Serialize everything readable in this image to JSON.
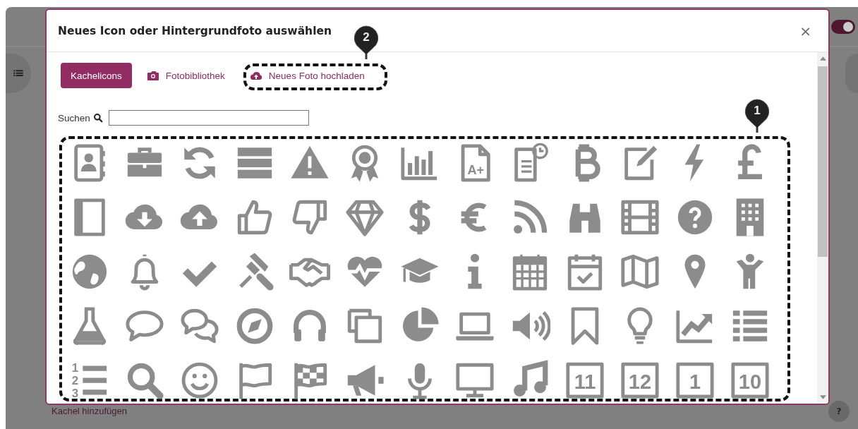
{
  "background": {
    "footer_link": "Kachel hinzufügen",
    "help_button": "?",
    "toggle": {
      "on": true
    }
  },
  "dialog": {
    "title": "Neues Icon oder Hintergrundfoto auswählen",
    "close": "×",
    "tabs": [
      {
        "label": "Kachelicons",
        "selected": true,
        "kind": "plain"
      },
      {
        "label": "Fotobibliothek",
        "selected": false,
        "kind": "camera"
      },
      {
        "label": "Neues Foto hochladen",
        "selected": false,
        "kind": "upload"
      }
    ],
    "search": {
      "label": "Suchen"
    },
    "icons": [
      {
        "kind": "glyph"
      },
      {
        "kind": "glyph"
      },
      {
        "kind": "glyph"
      },
      {
        "kind": "glyph"
      },
      {
        "kind": "glyph"
      },
      {
        "kind": "glyph"
      },
      {
        "kind": "glyph"
      },
      {
        "kind": "document",
        "text": "A+"
      },
      {
        "kind": "glyph"
      },
      {
        "kind": "glyph"
      },
      {
        "kind": "glyph"
      },
      {
        "kind": "glyph"
      },
      {
        "kind": "glyph"
      },
      {
        "kind": "glyph"
      },
      {
        "kind": "glyph"
      },
      {
        "kind": "glyph"
      },
      {
        "kind": "glyph"
      },
      {
        "kind": "glyph"
      },
      {
        "kind": "glyph"
      },
      {
        "kind": "glyph"
      },
      {
        "kind": "glyph"
      },
      {
        "kind": "glyph"
      },
      {
        "kind": "glyph"
      },
      {
        "kind": "glyph"
      },
      {
        "kind": "glyph"
      },
      {
        "kind": "glyph"
      },
      {
        "kind": "glyph"
      },
      {
        "kind": "glyph"
      },
      {
        "kind": "glyph"
      },
      {
        "kind": "glyph"
      },
      {
        "kind": "glyph"
      },
      {
        "kind": "glyph"
      },
      {
        "kind": "glyph"
      },
      {
        "kind": "glyph"
      },
      {
        "kind": "glyph"
      },
      {
        "kind": "glyph"
      },
      {
        "kind": "glyph"
      },
      {
        "kind": "glyph"
      },
      {
        "kind": "glyph"
      },
      {
        "kind": "glyph"
      },
      {
        "kind": "glyph"
      },
      {
        "kind": "glyph"
      },
      {
        "kind": "glyph"
      },
      {
        "kind": "glyph"
      },
      {
        "kind": "glyph"
      },
      {
        "kind": "glyph"
      },
      {
        "kind": "glyph"
      },
      {
        "kind": "glyph"
      },
      {
        "kind": "glyph"
      },
      {
        "kind": "glyph"
      },
      {
        "kind": "glyph"
      },
      {
        "kind": "glyph"
      },
      {
        "kind": "ordered-list",
        "digits": [
          "1",
          "2",
          "3"
        ]
      },
      {
        "kind": "glyph"
      },
      {
        "kind": "glyph"
      },
      {
        "kind": "glyph"
      },
      {
        "kind": "glyph"
      },
      {
        "kind": "glyph"
      },
      {
        "kind": "glyph"
      },
      {
        "kind": "glyph"
      },
      {
        "kind": "glyph"
      },
      {
        "kind": "date",
        "text": "11"
      },
      {
        "kind": "date",
        "text": "12"
      },
      {
        "kind": "date",
        "text": "1"
      },
      {
        "kind": "date",
        "text": "10"
      }
    ]
  },
  "callouts": [
    {
      "number": "2"
    },
    {
      "number": "1"
    }
  ]
}
